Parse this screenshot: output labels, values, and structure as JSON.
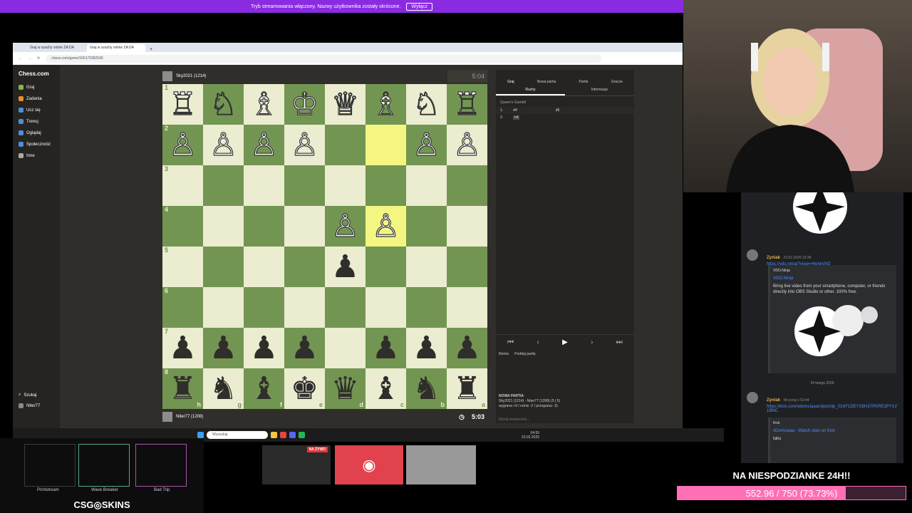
{
  "stream_bar": {
    "text": "Tryb streamowania włączony. Nazwy użytkownika zostały skrócone.",
    "button": "Wyłącz"
  },
  "browser": {
    "tabs": [
      "Graj w szachy online ZA DA",
      "Graj w szachy online ZA DA"
    ],
    "url": "chess.com/game/165172082596"
  },
  "chess_sidebar": {
    "logo": "Chess.com",
    "items": [
      {
        "label": "Graj",
        "color": "#81b64c"
      },
      {
        "label": "Zadania",
        "color": "#e58f2a"
      },
      {
        "label": "Ucz się",
        "color": "#4a90d9"
      },
      {
        "label": "Trenuj",
        "color": "#4a90d9"
      },
      {
        "label": "Oglądaj",
        "color": "#4a90d9"
      },
      {
        "label": "Społeczność",
        "color": "#4a90d9"
      },
      {
        "label": "Inne",
        "color": "#aaaaaa"
      }
    ],
    "bottom": [
      "Szukaj",
      "Niter77"
    ]
  },
  "top_player": {
    "name": "Sky2021 (1214)",
    "clock": "5:04"
  },
  "bottom_player": {
    "name": "Niter77 (1208)",
    "clock": "5:03"
  },
  "board": {
    "ranks": [
      "1",
      "2",
      "3",
      "4",
      "5",
      "6",
      "7",
      "8"
    ],
    "files": [
      "h",
      "g",
      "f",
      "e",
      "d",
      "c",
      "b",
      "a"
    ],
    "highlight": [
      "c2",
      "c4"
    ],
    "rows": [
      [
        "♖",
        "♘",
        "♗",
        "♔",
        "♕",
        "♗",
        "♘",
        "♖"
      ],
      [
        "♙",
        "♙",
        "♙",
        "♙",
        "",
        "",
        "♙",
        "♙"
      ],
      [
        "",
        "",
        "",
        "",
        "",
        "",
        "",
        ""
      ],
      [
        "",
        "",
        "",
        "",
        "♙",
        "♙",
        "",
        ""
      ],
      [
        "",
        "",
        "",
        "",
        "♟",
        "",
        "",
        ""
      ],
      [
        "",
        "",
        "",
        "",
        "",
        "",
        "",
        ""
      ],
      [
        "♟",
        "♟",
        "♟",
        "♟",
        "",
        "♟",
        "♟",
        "♟"
      ],
      [
        "♜",
        "♞",
        "♝",
        "♚",
        "♛",
        "♝",
        "♞",
        "♜"
      ]
    ]
  },
  "panel": {
    "tabs": [
      "Graj",
      "Nowa partia",
      "Partie",
      "Gracze"
    ],
    "subtabs": [
      "Ruchy",
      "Informacje"
    ],
    "opening": "Queen's Gambit",
    "moves": [
      {
        "num": "1.",
        "white": "d4",
        "black": "d5"
      },
      {
        "num": "2.",
        "white": "c4",
        "black": ""
      }
    ],
    "actions": [
      "Remis",
      "Poddaj partię"
    ],
    "new_game_title": "NOWA PARTIA",
    "new_game_line1": "Sky2021 (1214) - Niter77 (1208) (5 | 5)",
    "new_game_line2": "wygrana +9 / remis -2 / przegrana -11",
    "message_placeholder": "Wyślij wiadomość..."
  },
  "taskbar": {
    "search": "Wyszukaj",
    "time": "04:55",
    "date": "23.02.2026"
  },
  "chat": {
    "messages": [
      {
        "user": "Zyniak",
        "time": "23.02.2026 23:38",
        "link": "https://vdo.ninja/?view=HkmkVhD",
        "embed_site": "VDO.Ninja",
        "embed_title": "VDO.Ninja",
        "embed_text": "Bring live video from your smartphone, computer, or friends directly into OBS Studio or other. 100% free."
      },
      {
        "user": "Zyniak",
        "time": "Wczoraj o 02:44",
        "link": "https://kick.com/xdomciaaa/clips/clip_01KF1DEYS5H37PKRE3PY1V1BNC",
        "embed_site": "Kick",
        "embed_title": "xDomciaaa - Watch clips on Kick",
        "embed_text": "taku"
      }
    ],
    "date_divider": "24 lutego 2026"
  },
  "csgo": {
    "brand": "CSG◎SKINS",
    "guns": [
      "Printstream",
      "Wave Breaker",
      "Bad Trip"
    ]
  },
  "thumbs": {
    "live_badge": "NA ŻYWO"
  },
  "goal": {
    "title": "NA NIESPODZIANKE 24H!!",
    "progress_text": "552.96 / 750 (73.73%)",
    "fraction": 0.7373
  }
}
